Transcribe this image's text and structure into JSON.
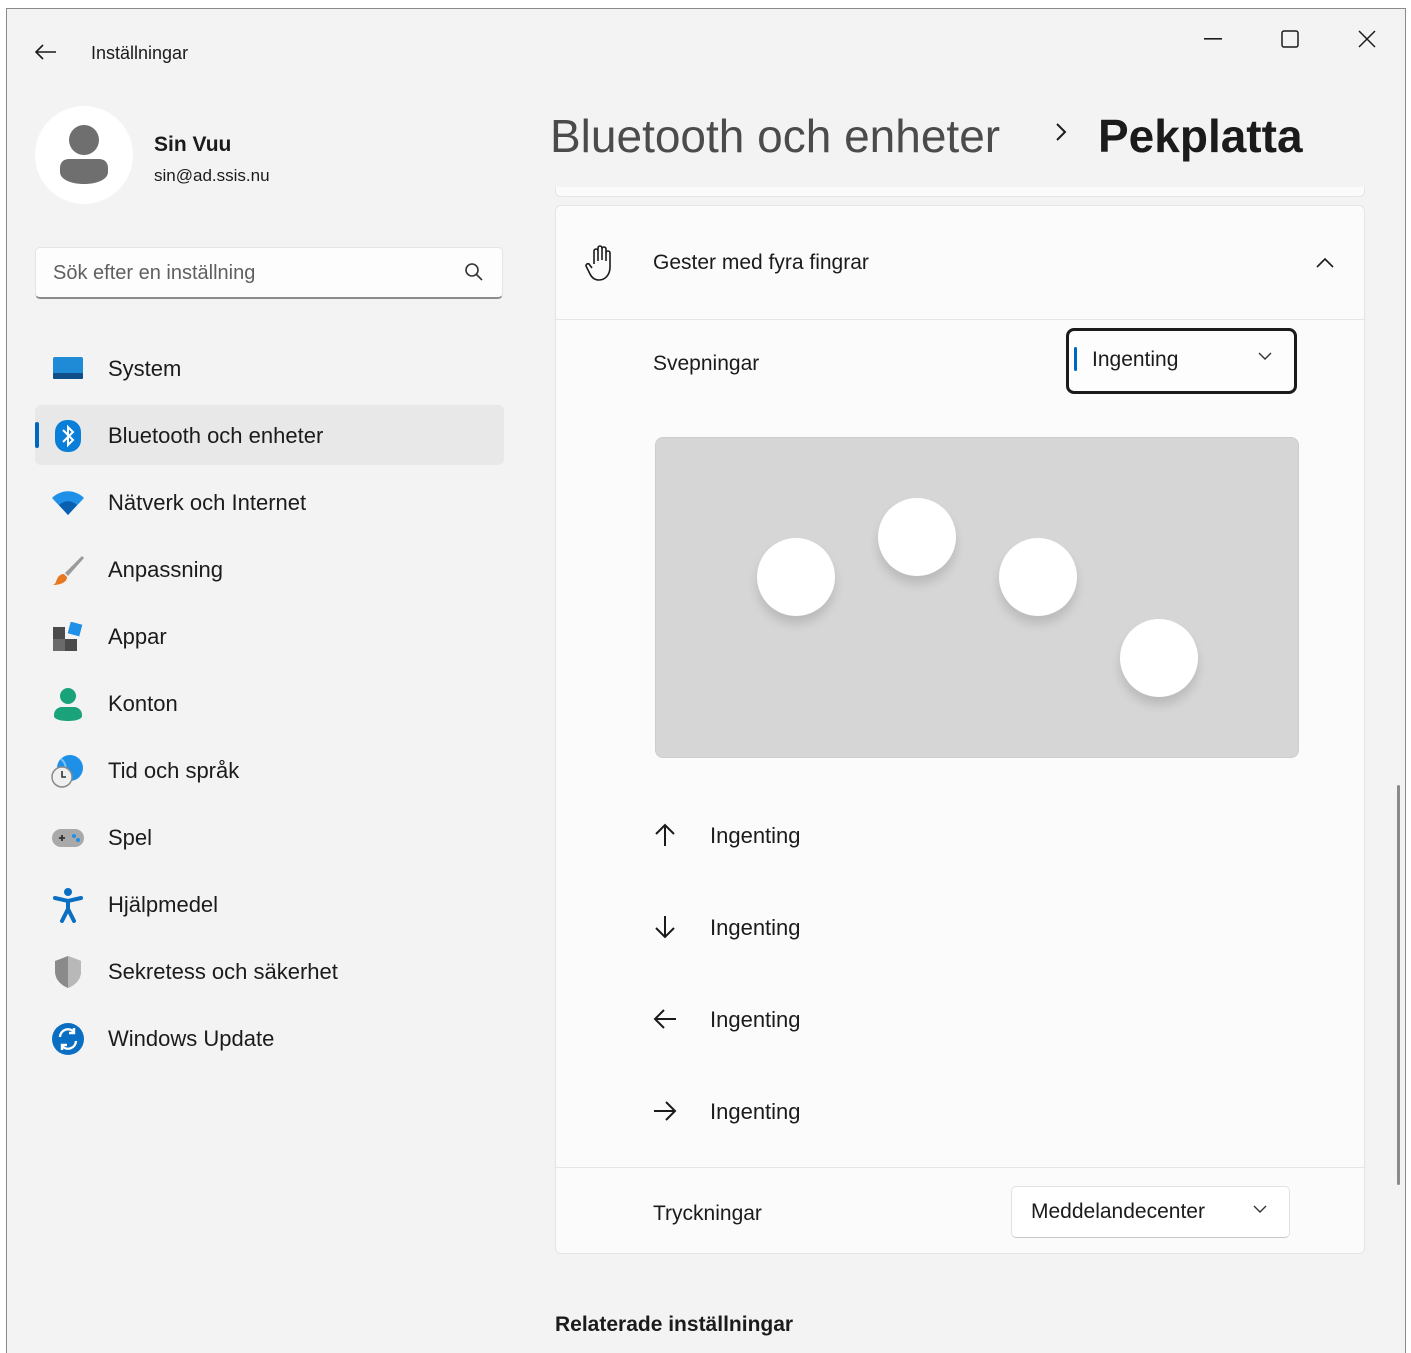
{
  "window": {
    "app_title": "Inställningar",
    "controls": {
      "minimize": "minimize-icon",
      "maximize": "maximize-icon",
      "close": "close-icon"
    }
  },
  "profile": {
    "name": "Sin Vuu",
    "email": "sin@ad.ssis.nu"
  },
  "search": {
    "placeholder": "Sök efter en inställning"
  },
  "sidebar": {
    "items": [
      {
        "label": "System",
        "icon": "system-icon",
        "active": false
      },
      {
        "label": "Bluetooth och enheter",
        "icon": "bluetooth-icon",
        "active": true
      },
      {
        "label": "Nätverk och Internet",
        "icon": "wifi-icon",
        "active": false
      },
      {
        "label": "Anpassning",
        "icon": "brush-icon",
        "active": false
      },
      {
        "label": "Appar",
        "icon": "apps-icon",
        "active": false
      },
      {
        "label": "Konton",
        "icon": "account-icon",
        "active": false
      },
      {
        "label": "Tid och språk",
        "icon": "time-language-icon",
        "active": false
      },
      {
        "label": "Spel",
        "icon": "gamepad-icon",
        "active": false
      },
      {
        "label": "Hjälpmedel",
        "icon": "accessibility-icon",
        "active": false
      },
      {
        "label": "Sekretess och säkerhet",
        "icon": "shield-icon",
        "active": false
      },
      {
        "label": "Windows Update",
        "icon": "windows-update-icon",
        "active": false
      }
    ]
  },
  "header": {
    "parent": "Bluetooth och enheter",
    "current": "Pekplatta"
  },
  "gestures": {
    "title": "Gester med fyra fingrar",
    "swipes": {
      "label": "Svepningar",
      "selected": "Ingenting"
    },
    "directions": [
      {
        "icon": "arrow-up-icon",
        "label": "Ingenting"
      },
      {
        "icon": "arrow-down-icon",
        "label": "Ingenting"
      },
      {
        "icon": "arrow-left-icon",
        "label": "Ingenting"
      },
      {
        "icon": "arrow-right-icon",
        "label": "Ingenting"
      }
    ],
    "taps": {
      "label": "Tryckningar",
      "selected": "Meddelandecenter"
    }
  },
  "related": {
    "title": "Relaterade inställningar"
  },
  "colors": {
    "accent": "#0067c0",
    "window_bg": "#f3f3f3",
    "card_bg": "#fbfbfb",
    "illustration_bg": "#d6d6d6"
  }
}
